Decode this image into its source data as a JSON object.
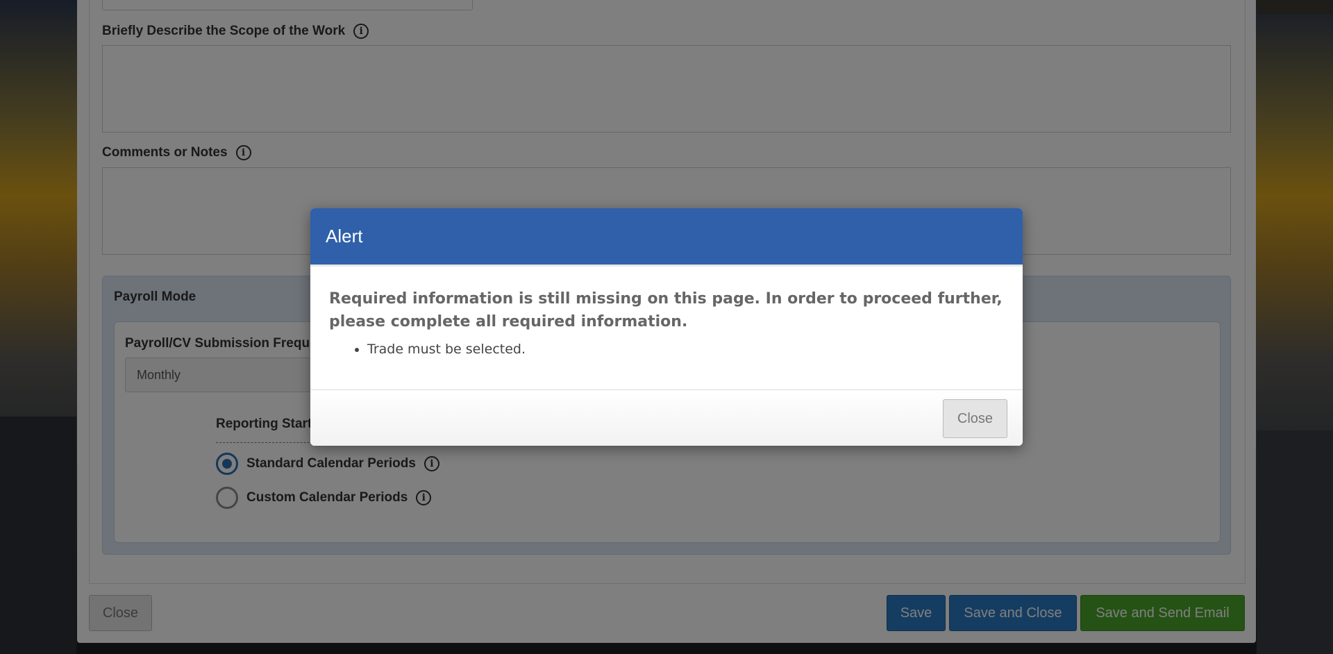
{
  "form": {
    "scope_label": "Briefly Describe the Scope of the Work",
    "comments_label": "Comments or Notes",
    "payroll_mode_label": "Payroll Mode",
    "frequency_label": "Payroll/CV Submission Freque",
    "frequency_value": "Monthly",
    "reporting_start_label": "Reporting Start",
    "radio_standard_label": "Standard Calendar Periods",
    "radio_custom_label": "Custom Calendar Periods",
    "radio_selected": "standard"
  },
  "footer": {
    "close_label": "Close",
    "save_label": "Save",
    "save_close_label": "Save and Close",
    "save_email_label": "Save and Send Email"
  },
  "modal": {
    "title": "Alert",
    "message": "Required information is still missing on this page. In order to proceed further, please complete all required information.",
    "errors": [
      "Trade must be selected."
    ],
    "close_label": "Close"
  },
  "icons": {
    "info": "info-circle-icon"
  },
  "colors": {
    "modal_header": "#2f60a9",
    "save_blue": "#2a7ac2",
    "save_email_green": "#4aa52b"
  }
}
